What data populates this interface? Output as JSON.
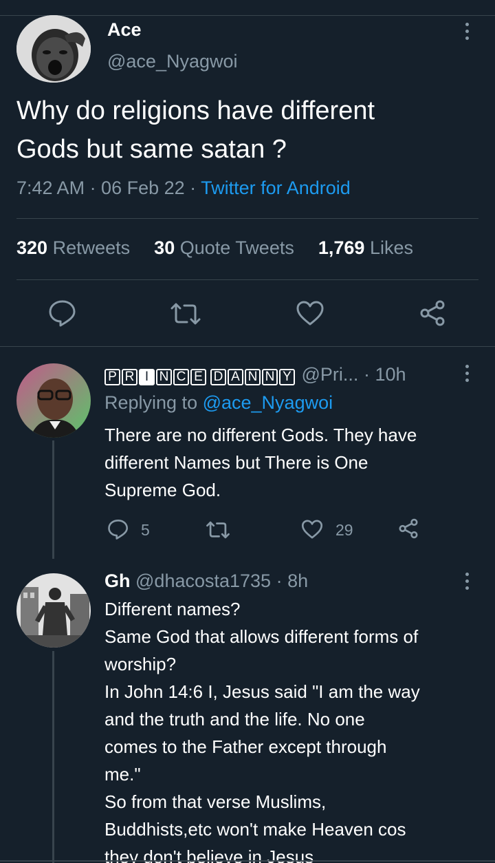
{
  "main_tweet": {
    "author_name": "Ace",
    "handle": "@ace_Nyagwoi",
    "text_line1": "Why do religions have different",
    "text_line2": "Gods but same satan ?",
    "time": "7:42 AM · 06 Feb 22 · ",
    "source": "Twitter for Android",
    "retweets_count": "320",
    "retweets_label": "Retweets",
    "quotes_count": "30",
    "quotes_label": "Quote Tweets",
    "likes_count": "1,769",
    "likes_label": "Likes"
  },
  "replies": [
    {
      "author_letters_1": [
        "P",
        "R",
        "I",
        "N",
        "C",
        "E"
      ],
      "author_letters_2": [
        "D",
        "A",
        "N",
        "N",
        "Y"
      ],
      "handle": "@Pri...",
      "time": "· 10h",
      "replying_prefix": "Replying to ",
      "replying_handle": "@ace_Nyagwoi",
      "text": "There are no different Gods. They have\ndifferent Names but There is One\nSupreme God.",
      "reply_count": "5",
      "retweet_count": "",
      "like_count": "29"
    },
    {
      "author_name": "Gh",
      "handle": "@dhacosta1735 · 8h",
      "text": "Different names?\nSame God that allows different forms of\nworship?\nIn John 14:6 I, Jesus said \"I am the way\nand the truth and the life. No one\ncomes to the Father except through\nme.\"\nSo from that verse Muslims,\nBuddhists,etc won't make Heaven cos\nthey don't believe in Jesus"
    }
  ],
  "colors": {
    "background": "#15202b",
    "accent": "#1d9bf0",
    "muted": "#8899a6",
    "divider": "#38444d"
  },
  "icons": [
    "more-icon",
    "reply-icon",
    "retweet-icon",
    "like-icon",
    "share-icon"
  ]
}
